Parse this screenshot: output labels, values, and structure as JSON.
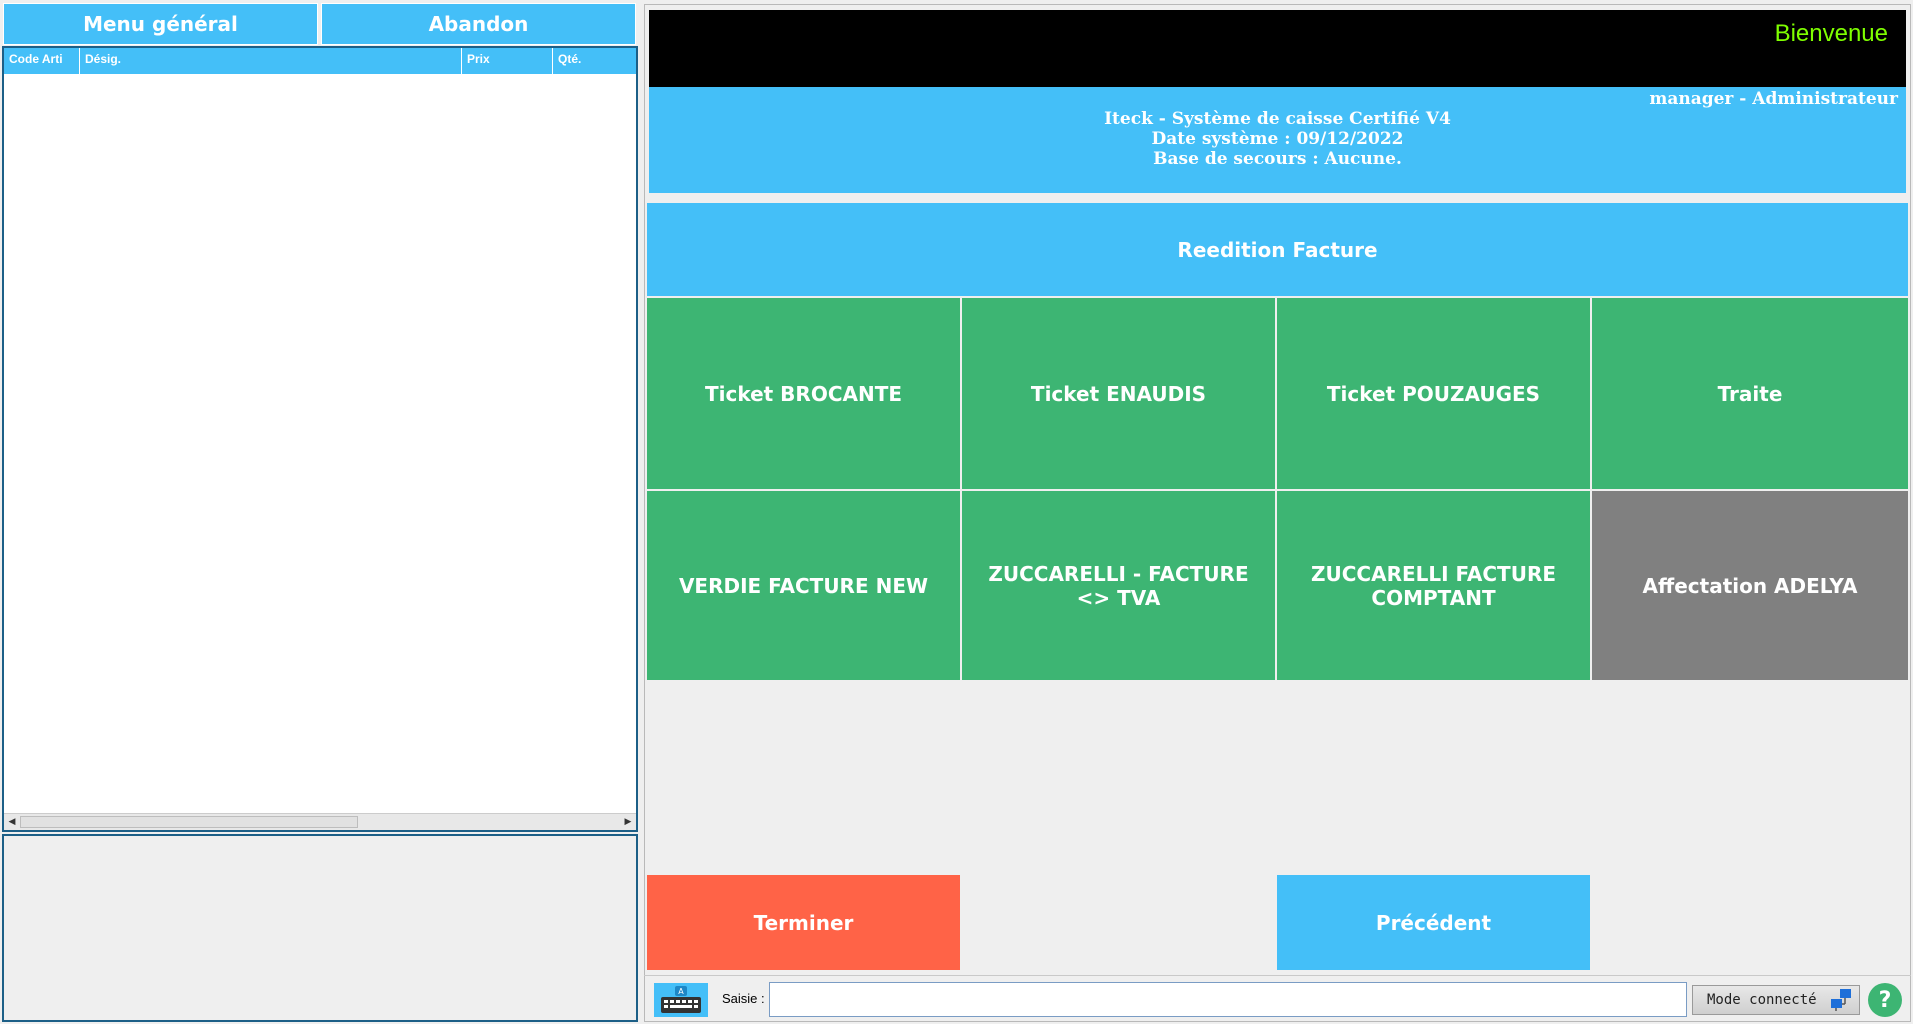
{
  "top_buttons": {
    "menu": "Menu général",
    "abandon": "Abandon"
  },
  "table": {
    "headers": [
      "Code Arti",
      "Désig.",
      "Prix",
      "Qté."
    ]
  },
  "header": {
    "welcome": "Bienvenue",
    "user": "manager - Administrateur",
    "system": "Iteck - Système de caisse Certifié V4",
    "date": "Date système : 09/12/2022",
    "backup": "Base de secours : Aucune."
  },
  "reedition": "Reedition Facture",
  "tiles": {
    "t1": "Ticket BROCANTE",
    "t2": "Ticket ENAUDIS",
    "t3": "Ticket POUZAUGES",
    "t4": "Traite",
    "t5": "VERDIE FACTURE NEW",
    "t6": "ZUCCARELLI - FACTURE <> TVA",
    "t7": "ZUCCARELLI FACTURE COMPTANT",
    "t8": "Affectation ADELYA"
  },
  "actions": {
    "terminer": "Terminer",
    "precedent": "Précédent"
  },
  "input_bar": {
    "label": "Saisie :",
    "value": "",
    "mode": "Mode connecté",
    "help": "?"
  },
  "colors": {
    "accent": "#44bff8",
    "green": "#3db573",
    "grey": "#808080",
    "red": "#ff6347",
    "welcome": "#7fff00"
  },
  "icons": [
    "keyboard-icon",
    "network-icon",
    "help-icon"
  ]
}
